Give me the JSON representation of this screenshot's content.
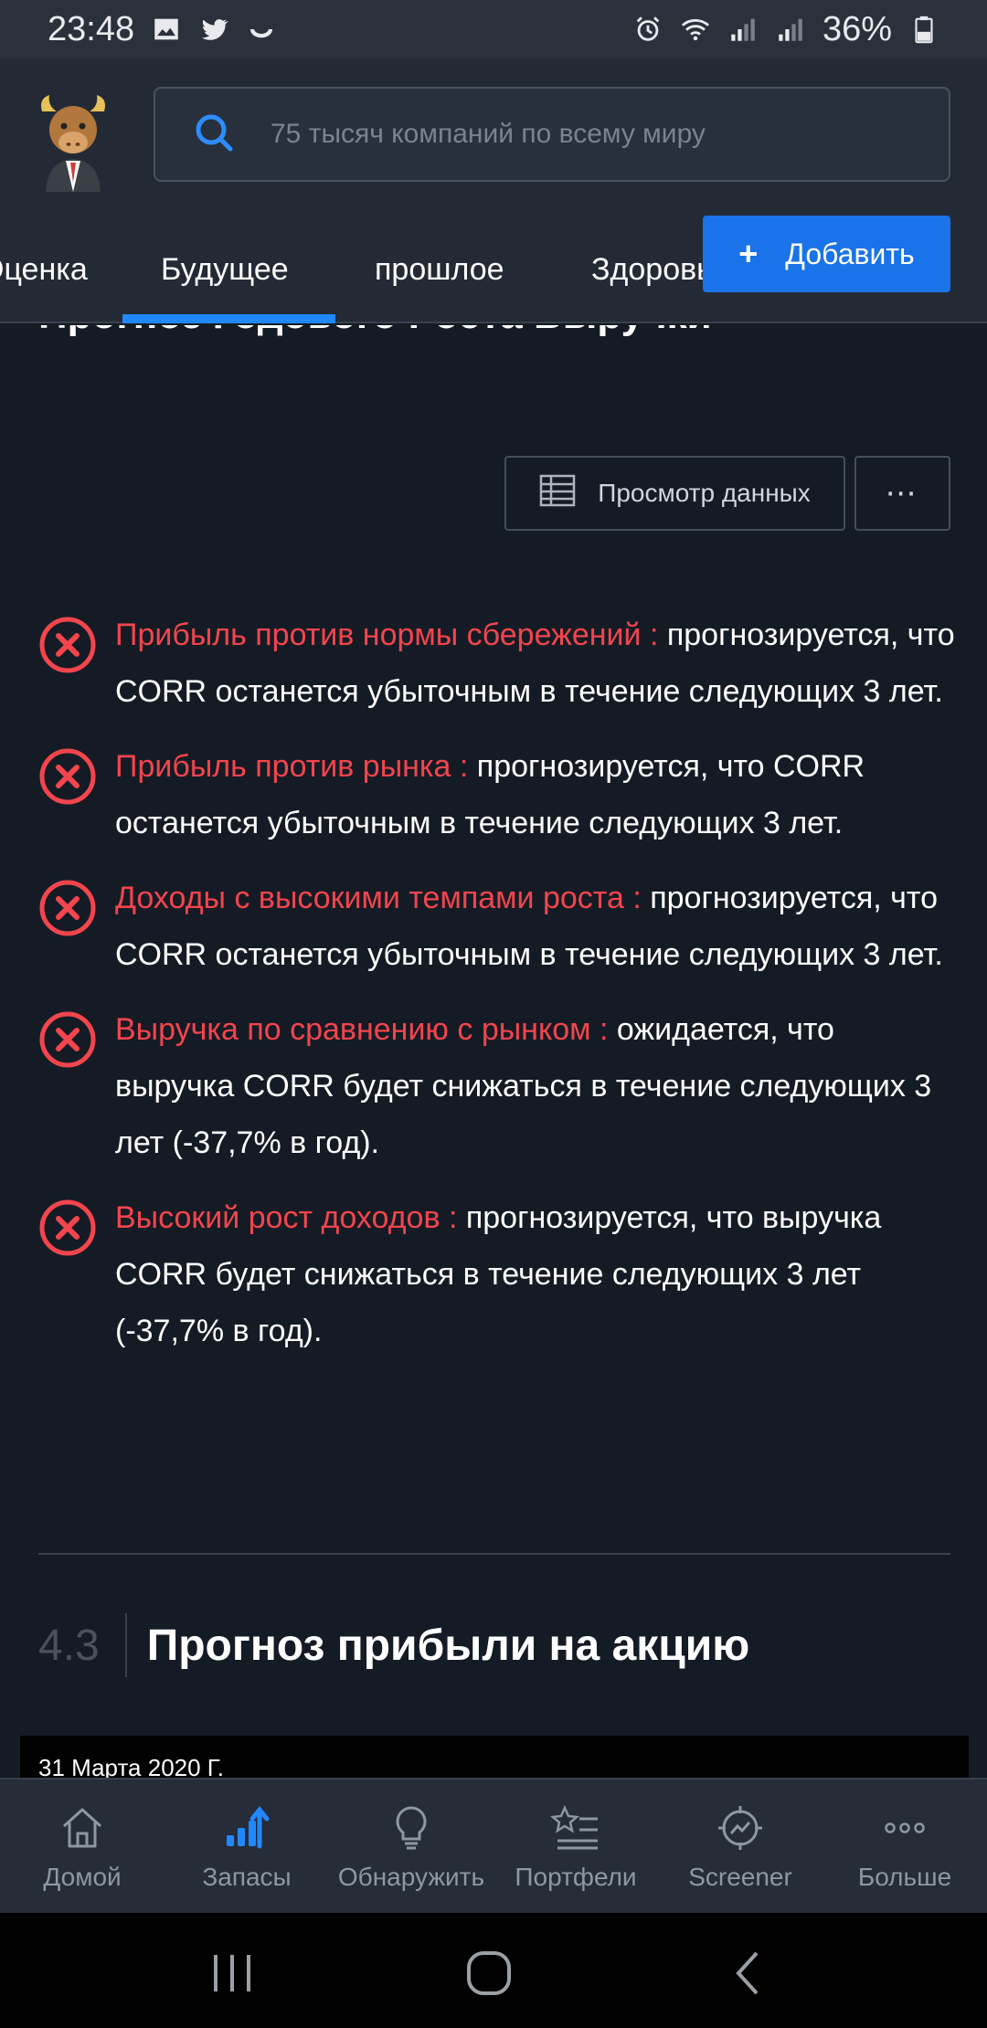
{
  "status_bar": {
    "time": "23:48",
    "battery": "36%",
    "icons": [
      "gallery-icon",
      "twitter-icon",
      "moon-icon",
      "alarm-icon",
      "wifi-icon",
      "signal-icon",
      "signal-icon",
      "battery-icon"
    ]
  },
  "header": {
    "logo": "bull-mascot-avatar",
    "search_placeholder": "75 тысяч компаний по всему миру",
    "tabs": [
      "Оценка",
      "Будущее",
      "прошлое",
      "Здоровье"
    ],
    "active_tab": "Будущее",
    "add_button_label": "Добавить"
  },
  "section_top": {
    "partial_heading": "Прогноз Годового Роста Выручки",
    "view_data_label": "Просмотр данных",
    "more_label": "⋯"
  },
  "checks": [
    {
      "title": "Прибыль против нормы сбережений :",
      "desc": " прогнозируется, что CORR останется убыточным в течение следующих 3 лет."
    },
    {
      "title": "Прибыль против рынка :",
      "desc": " прогнозируется, что CORR останется убыточным в течение следующих 3 лет."
    },
    {
      "title": "Доходы с высокими темпами роста :",
      "desc": " прогнозируется, что CORR останется убыточным в течение следующих 3 лет."
    },
    {
      "title": "Выручка по сравнению с рынком :",
      "desc": " ожидается, что выручка CORR будет снижаться в течение следующих 3 лет (-37,7% в год)."
    },
    {
      "title": "Высокий рост доходов :",
      "desc": " прогнозируется, что выручка CORR будет снижаться в течение следующих 3 лет (-37,7% в год)."
    }
  ],
  "section_43": {
    "number": "4.3",
    "title": "Прогноз прибыли на акцию",
    "chart_date": "31 Марта 2020 Г."
  },
  "bottom_nav": {
    "items": [
      {
        "label": "Домой",
        "icon": "home-icon"
      },
      {
        "label": "Запасы",
        "icon": "stocks-icon"
      },
      {
        "label": "Обнаружить",
        "icon": "lightbulb-icon"
      },
      {
        "label": "Портфели",
        "icon": "portfolio-icon"
      },
      {
        "label": "Screener",
        "icon": "screener-icon"
      },
      {
        "label": "Больше",
        "icon": "more-icon"
      }
    ],
    "active_index": 1
  },
  "colors": {
    "background": "#151b24",
    "header": "#232a35",
    "accent_blue": "#1a73e8",
    "negative_red": "#f2454e"
  }
}
